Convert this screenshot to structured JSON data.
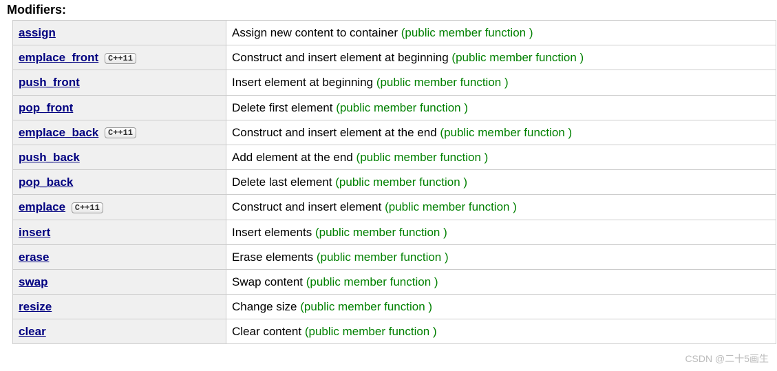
{
  "section": {
    "title": "Modifiers:"
  },
  "annotation_label": "(public member function )",
  "cpp11_badge": "C++11",
  "rows": [
    {
      "name": "assign",
      "cpp11": false,
      "desc": "Assign new content to container "
    },
    {
      "name": "emplace_front",
      "cpp11": true,
      "desc": "Construct and insert element at beginning "
    },
    {
      "name": "push_front",
      "cpp11": false,
      "desc": "Insert element at beginning "
    },
    {
      "name": "pop_front",
      "cpp11": false,
      "desc": "Delete first element "
    },
    {
      "name": "emplace_back",
      "cpp11": true,
      "desc": "Construct and insert element at the end "
    },
    {
      "name": "push_back",
      "cpp11": false,
      "desc": "Add element at the end "
    },
    {
      "name": "pop_back",
      "cpp11": false,
      "desc": "Delete last element "
    },
    {
      "name": "emplace",
      "cpp11": true,
      "desc": "Construct and insert element "
    },
    {
      "name": "insert",
      "cpp11": false,
      "desc": "Insert elements "
    },
    {
      "name": "erase",
      "cpp11": false,
      "desc": "Erase elements "
    },
    {
      "name": "swap",
      "cpp11": false,
      "desc": "Swap content "
    },
    {
      "name": "resize",
      "cpp11": false,
      "desc": "Change size "
    },
    {
      "name": "clear",
      "cpp11": false,
      "desc": "Clear content "
    }
  ],
  "watermark": "CSDN @二十5画生"
}
